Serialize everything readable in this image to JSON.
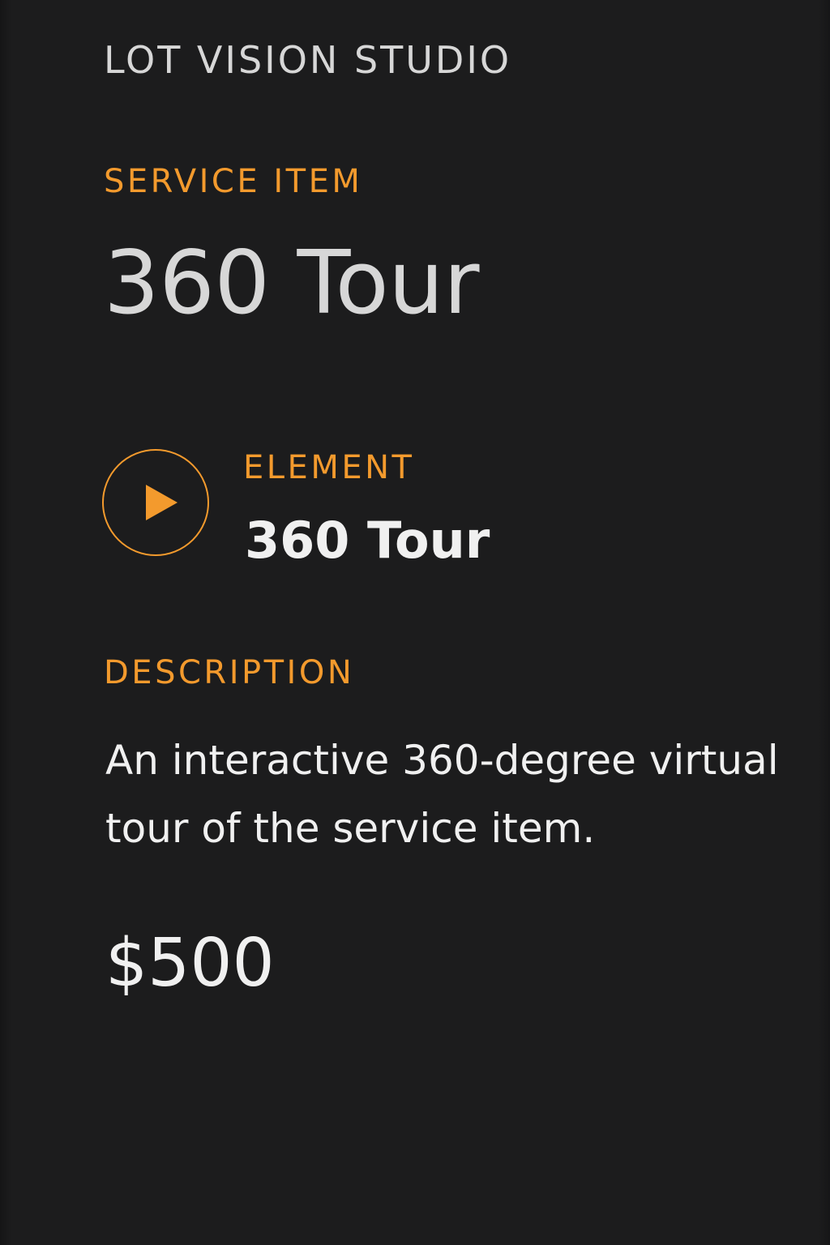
{
  "brand": {
    "name": "LOT VISION STUDIO"
  },
  "service_item": {
    "label": "SERVICE ITEM",
    "title": "360 Tour"
  },
  "element": {
    "label": "ELEMENT",
    "value": "360 Tour",
    "icon": "play-icon"
  },
  "description": {
    "label": "DESCRIPTION",
    "text": "An interactive 360-degree virtual tour of the service item."
  },
  "price": "$500",
  "colors": {
    "background": "#1c1c1d",
    "accent": "#f39a2d",
    "text": "#d7d7d7",
    "text_bright": "#f0f0f0"
  }
}
